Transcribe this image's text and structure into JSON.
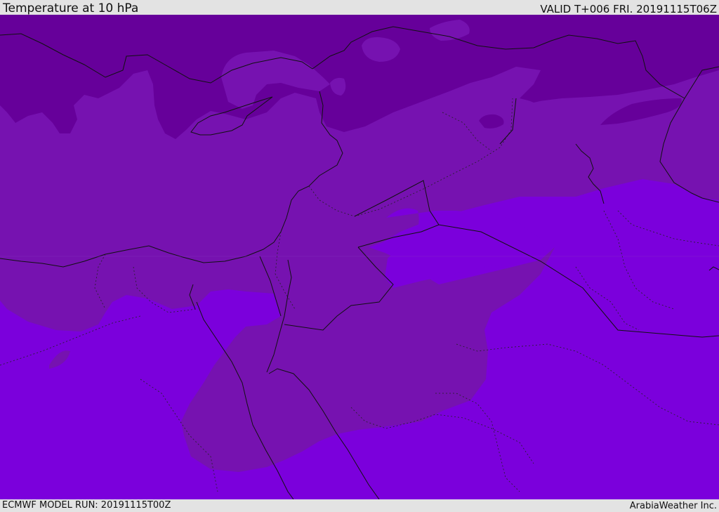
{
  "header": {
    "title": "Temperature at 10 hPa",
    "valid": "VALID T+006 FRI. 20191115T06Z"
  },
  "footer": {
    "model_run": "ECMWF MODEL RUN: 20191115T00Z",
    "credit": "ArabiaWeather Inc."
  },
  "colors": {
    "band_coldest": "#66009a",
    "band_cold": "#7612b0",
    "band_mild": "#7b00dc",
    "coastline": "#111111",
    "boundary": "#222222"
  }
}
